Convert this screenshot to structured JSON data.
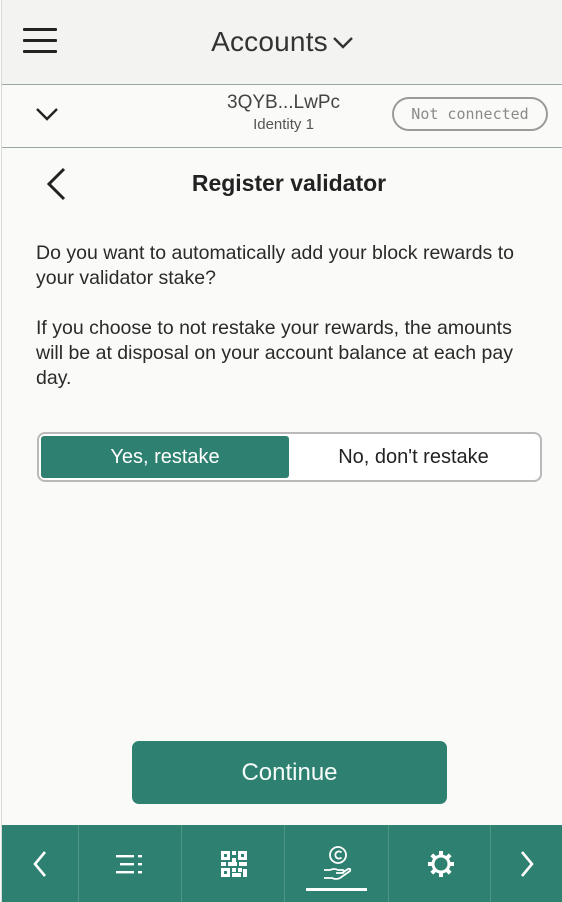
{
  "header": {
    "title": "Accounts",
    "menu_icon": "hamburger-icon",
    "dropdown_icon": "chevron-down-icon"
  },
  "account": {
    "address": "3QYB...LwPc",
    "identity": "Identity 1",
    "status": "Not connected",
    "expand_icon": "chevron-down-icon"
  },
  "page": {
    "title": "Register validator",
    "back_icon": "chevron-left-icon",
    "question": "Do you want to automatically add your block rewards to your validator stake?",
    "explanation": "If you choose to not restake your rewards, the amounts will be at disposal on your account balance at each pay day.",
    "options": {
      "yes": "Yes, restake",
      "no": "No, don't restake",
      "selected": "yes"
    },
    "continue_label": "Continue"
  },
  "bottom_nav": {
    "items": [
      {
        "icon": "chevron-left-icon"
      },
      {
        "icon": "list-icon"
      },
      {
        "icon": "qr-code-icon"
      },
      {
        "icon": "stake-coin-hand-icon",
        "active": true
      },
      {
        "icon": "gear-icon"
      },
      {
        "icon": "chevron-right-icon"
      }
    ]
  },
  "colors": {
    "accent": "#2e8070",
    "background": "#fafaf8",
    "header_bg": "#f3f3f2"
  }
}
